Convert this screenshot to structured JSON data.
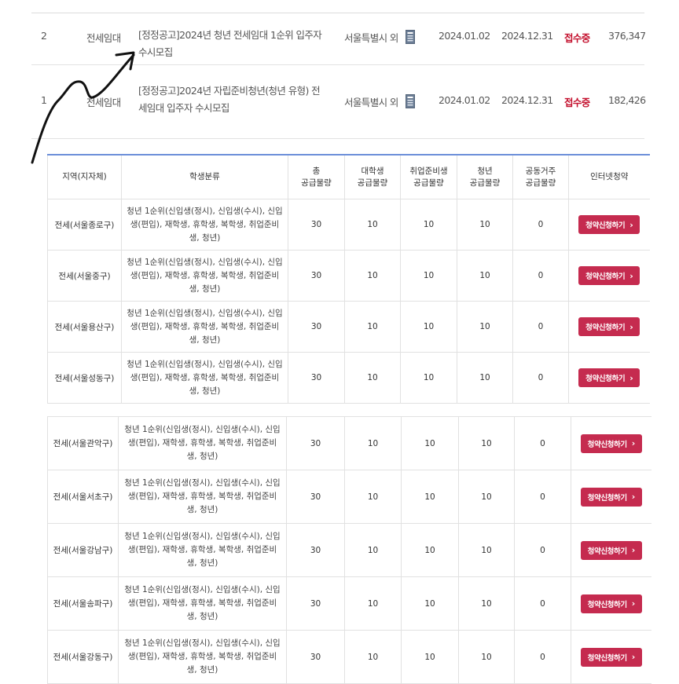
{
  "notices": [
    {
      "num": "2",
      "type": "전세임대",
      "title": "[정정공고]2024년 청년 전세임대 1순위 입주자 수시모집",
      "region": "서울특별시 외",
      "file_icon": "document-icon",
      "start": "2024.01.02",
      "end": "2024.12.31",
      "status": "접수중",
      "views": "376,347"
    },
    {
      "num": "1",
      "type": "전세임대",
      "title": "[정정공고]2024년 자립준비청년(청년 유형) 전세임대 입주자 수시모집",
      "region": "서울특별시 외",
      "file_icon": "document-icon",
      "start": "2024.01.02",
      "end": "2024.12.31",
      "status": "접수중",
      "views": "182,426"
    }
  ],
  "colors": {
    "accent": "#c52b4f",
    "status": "#c4122f",
    "table_top_border": "#6c8fd9"
  },
  "table_headers": [
    "지역(지자체)",
    "학생분류",
    "총\n공급물량",
    "대학생\n공급물량",
    "취업준비생\n공급물량",
    "청년\n공급물량",
    "공동거주\n공급물량",
    "인터넷청약"
  ],
  "table1_rows": [
    {
      "region": "전세(서울종로구)",
      "classification": "청년 1순위(신입생(정시), 신입생(수시), 신입생(편입), 재학생, 휴학생, 복학생, 취업준비생, 청년)",
      "total": "30",
      "univ": "10",
      "job": "10",
      "youth": "10",
      "shared": "0",
      "apply": "청약신청하기"
    },
    {
      "region": "전세(서울중구)",
      "classification": "청년 1순위(신입생(정시), 신입생(수시), 신입생(편입), 재학생, 휴학생, 복학생, 취업준비생, 청년)",
      "total": "30",
      "univ": "10",
      "job": "10",
      "youth": "10",
      "shared": "0",
      "apply": "청약신청하기"
    },
    {
      "region": "전세(서울용산구)",
      "classification": "청년 1순위(신입생(정시), 신입생(수시), 신입생(편입), 재학생, 휴학생, 복학생, 취업준비생, 청년)",
      "total": "30",
      "univ": "10",
      "job": "10",
      "youth": "10",
      "shared": "0",
      "apply": "청약신청하기"
    },
    {
      "region": "전세(서울성동구)",
      "classification": "청년 1순위(신입생(정시), 신입생(수시), 신입생(편입), 재학생, 휴학생, 복학생, 취업준비생, 청년)",
      "total": "30",
      "univ": "10",
      "job": "10",
      "youth": "10",
      "shared": "0",
      "apply": "청약신청하기"
    }
  ],
  "table2_rows": [
    {
      "region": "전세(서울관악구)",
      "classification": "청년 1순위(신입생(정시), 신입생(수시), 신입생(편입), 재학생, 휴학생, 복학생, 취업준비생, 청년)",
      "total": "30",
      "univ": "10",
      "job": "10",
      "youth": "10",
      "shared": "0",
      "apply": "청약신청하기"
    },
    {
      "region": "전세(서울서초구)",
      "classification": "청년 1순위(신입생(정시), 신입생(수시), 신입생(편입), 재학생, 휴학생, 복학생, 취업준비생, 청년)",
      "total": "30",
      "univ": "10",
      "job": "10",
      "youth": "10",
      "shared": "0",
      "apply": "청약신청하기"
    },
    {
      "region": "전세(서울강남구)",
      "classification": "청년 1순위(신입생(정시), 신입생(수시), 신입생(편입), 재학생, 휴학생, 복학생, 취업준비생, 청년)",
      "total": "30",
      "univ": "10",
      "job": "10",
      "youth": "10",
      "shared": "0",
      "apply": "청약신청하기"
    },
    {
      "region": "전세(서울송파구)",
      "classification": "청년 1순위(신입생(정시), 신입생(수시), 신입생(편입), 재학생, 휴학생, 복학생, 취업준비생, 청년)",
      "total": "30",
      "univ": "10",
      "job": "10",
      "youth": "10",
      "shared": "0",
      "apply": "청약신청하기"
    },
    {
      "region": "전세(서울강동구)",
      "classification": "청년 1순위(신입생(정시), 신입생(수시), 신입생(편입), 재학생, 휴학생, 복학생, 취업준비생, 청년)",
      "total": "30",
      "univ": "10",
      "job": "10",
      "youth": "10",
      "shared": "0",
      "apply": "청약신청하기"
    }
  ]
}
